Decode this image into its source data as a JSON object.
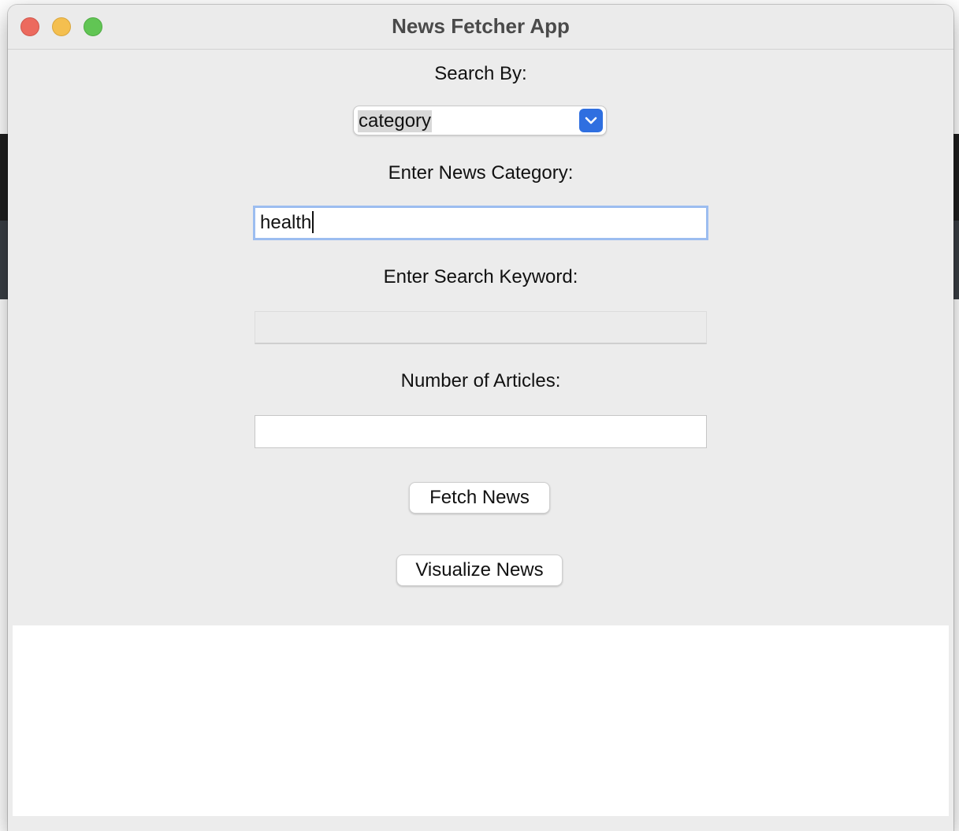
{
  "window": {
    "title": "News Fetcher App"
  },
  "form": {
    "search_by_label": "Search By:",
    "search_by_value": "category",
    "category_label": "Enter News Category:",
    "category_value": "health",
    "keyword_label": "Enter Search Keyword:",
    "keyword_value": "",
    "count_label": "Number of Articles:",
    "count_value": ""
  },
  "buttons": {
    "fetch_label": "Fetch News",
    "visualize_label": "Visualize News"
  },
  "output": {
    "text": ""
  },
  "icons": {
    "close": "close-icon",
    "minimize": "minimize-icon",
    "maximize": "maximize-icon",
    "dropdown": "chevron-down-icon"
  },
  "colors": {
    "accent": "#2f6fe0",
    "focus_ring": "#9cbdf0",
    "close": "#ec6a5e",
    "minimize": "#f4bf4f",
    "maximize": "#61c554"
  }
}
